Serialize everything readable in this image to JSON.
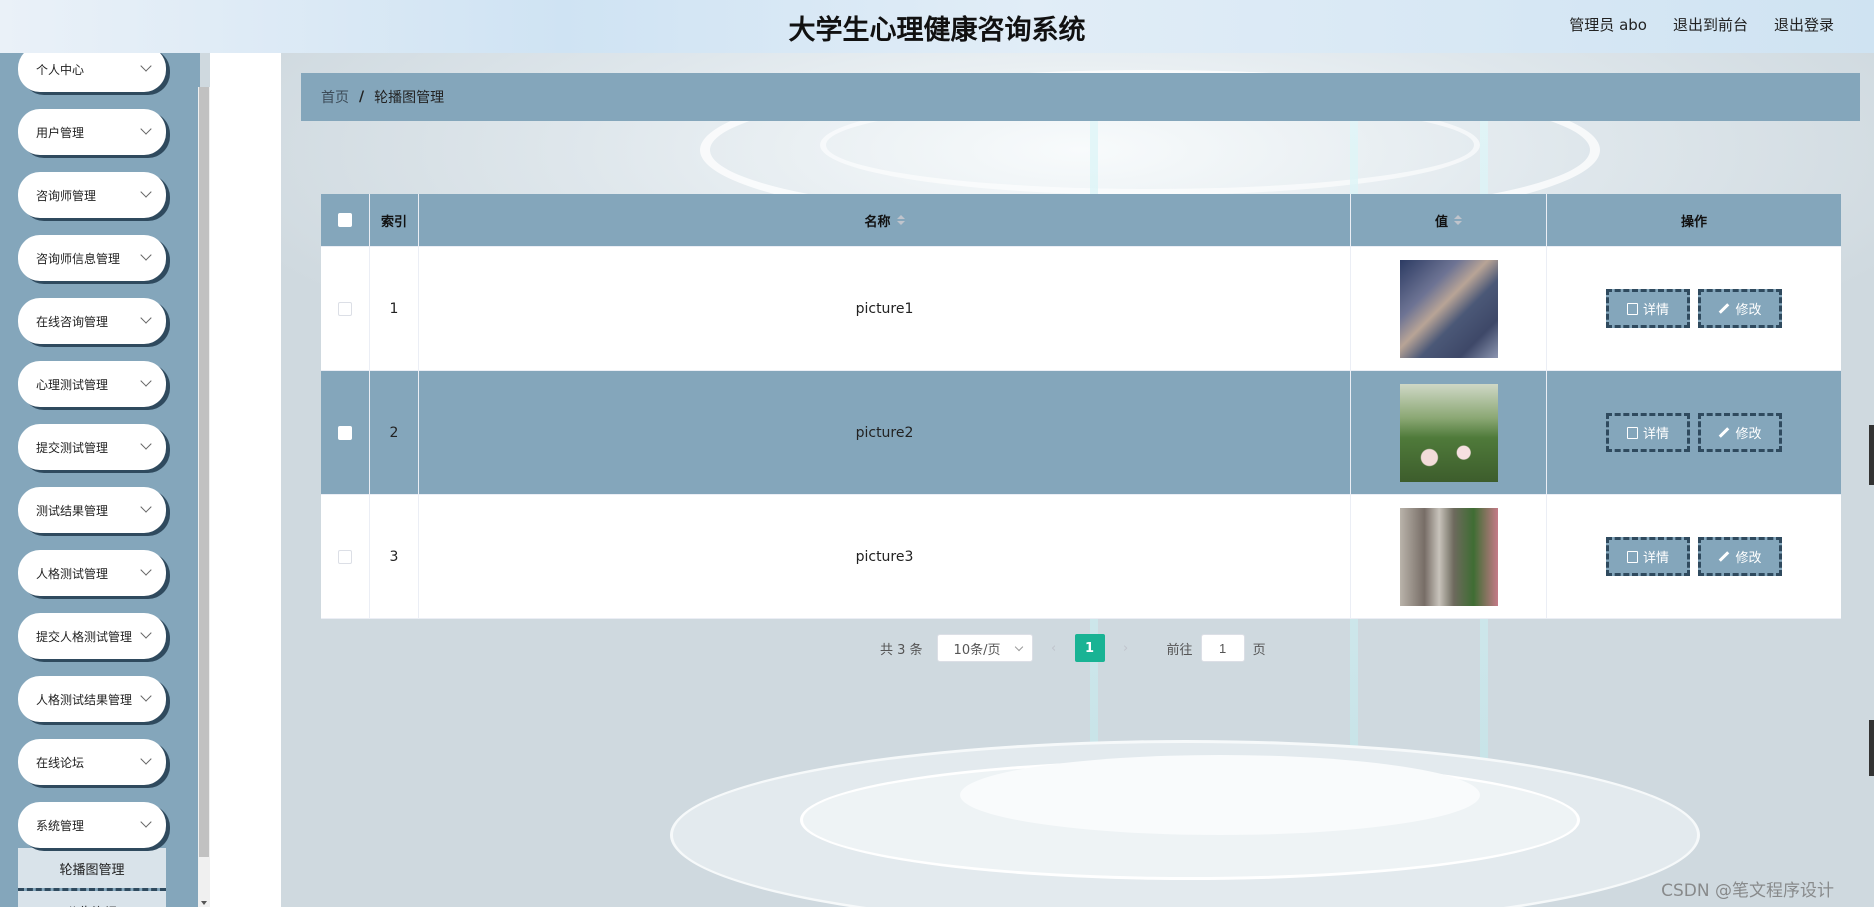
{
  "header": {
    "title": "大学生心理健康咨询系统",
    "user_label": "管理员 abo",
    "front_label": "退出到前台",
    "logout_label": "退出登录"
  },
  "sidebar": {
    "items": [
      {
        "label": "个人中心"
      },
      {
        "label": "用户管理"
      },
      {
        "label": "咨询师管理"
      },
      {
        "label": "咨询师信息管理"
      },
      {
        "label": "在线咨询管理"
      },
      {
        "label": "心理测试管理"
      },
      {
        "label": "提交测试管理"
      },
      {
        "label": "测试结果管理"
      },
      {
        "label": "人格测试管理"
      },
      {
        "label": "提交人格测试管理"
      },
      {
        "label": "人格测试结果管理"
      },
      {
        "label": "在线论坛"
      },
      {
        "label": "系统管理"
      }
    ],
    "subitems": [
      {
        "label": "轮播图管理"
      },
      {
        "label": "公告资讯"
      }
    ]
  },
  "breadcrumb": {
    "home": "首页",
    "separator": "/",
    "current": "轮播图管理"
  },
  "table": {
    "columns": {
      "index": "索引",
      "name": "名称",
      "value": "值",
      "ops": "操作"
    },
    "rows": [
      {
        "index": "1",
        "name": "picture1",
        "detail": "详情",
        "edit": "修改"
      },
      {
        "index": "2",
        "name": "picture2",
        "detail": "详情",
        "edit": "修改"
      },
      {
        "index": "3",
        "name": "picture3",
        "detail": "详情",
        "edit": "修改"
      }
    ]
  },
  "pagination": {
    "total": "共 3 条",
    "page_size": "10条/页",
    "current_page": "1",
    "goto_label": "前往",
    "goto_value": "1",
    "page_suffix": "页"
  },
  "watermark": "CSDN @笔文程序设计",
  "colors": {
    "accent": "#84a6bb",
    "dark_accent": "#2f4a5e",
    "pager_active": "#19b394"
  }
}
